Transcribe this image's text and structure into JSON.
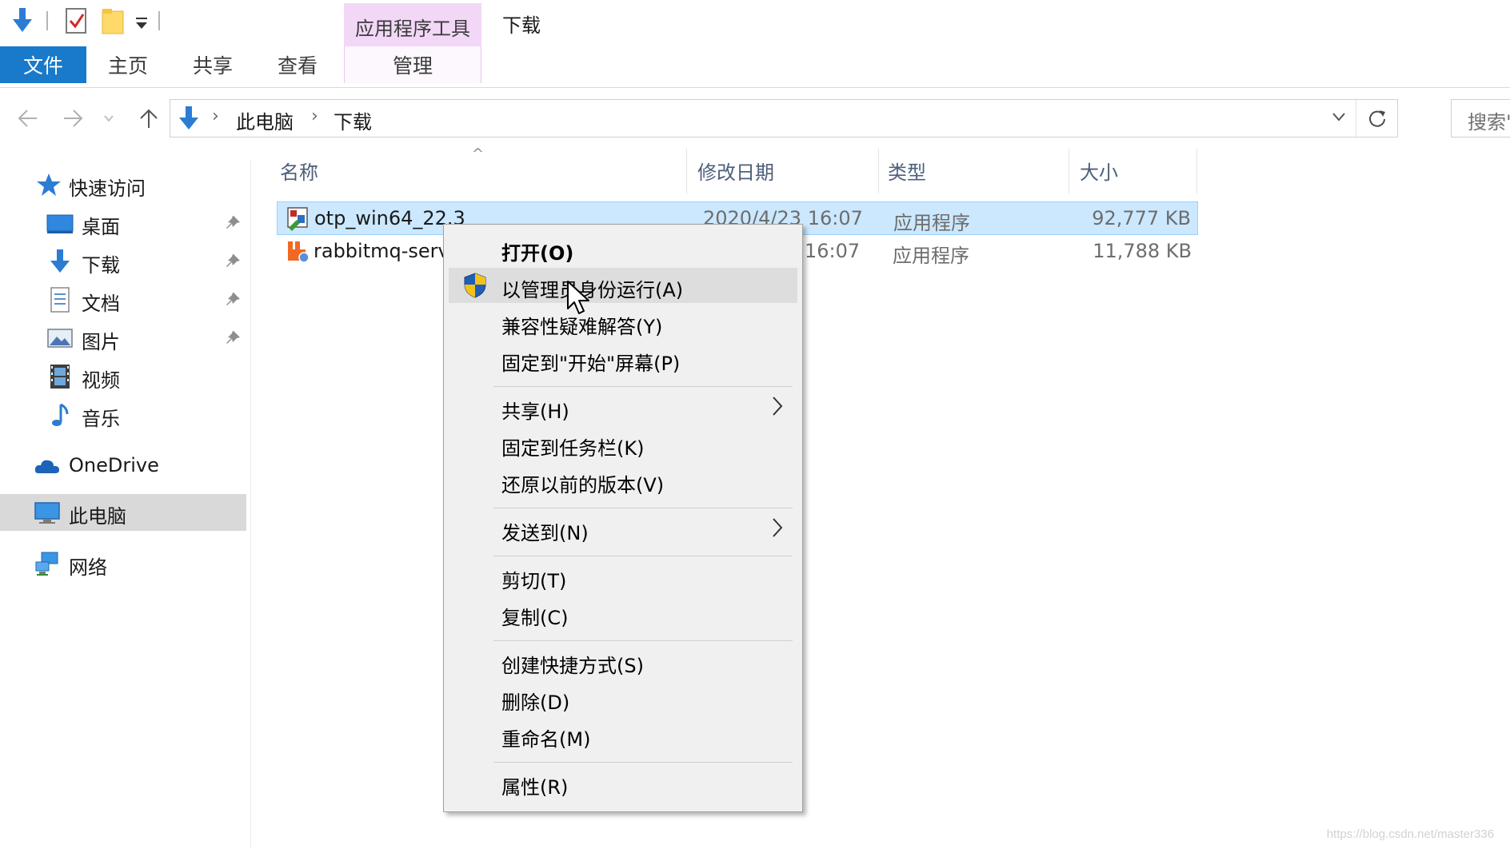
{
  "quick_access_toolbar": {
    "icons": [
      "download-arrow-icon",
      "properties-check-icon",
      "new-folder-icon",
      "customize-dropdown-icon"
    ]
  },
  "ribbon": {
    "contextual_group_label": "应用程序工具",
    "window_title": "下载",
    "tabs": {
      "file": "文件",
      "home": "主页",
      "share": "共享",
      "view": "查看",
      "manage": "管理"
    }
  },
  "address_bar": {
    "breadcrumbs": [
      "此电脑",
      "下载"
    ],
    "search_placeholder": "搜索\"下载\""
  },
  "sidebar": {
    "quick_access": "快速访问",
    "items": [
      {
        "label": "桌面",
        "icon": "desktop-icon",
        "pinned": true
      },
      {
        "label": "下载",
        "icon": "download-icon",
        "pinned": true
      },
      {
        "label": "文档",
        "icon": "documents-icon",
        "pinned": true
      },
      {
        "label": "图片",
        "icon": "pictures-icon",
        "pinned": true
      },
      {
        "label": "视频",
        "icon": "videos-icon",
        "pinned": false
      },
      {
        "label": "音乐",
        "icon": "music-icon",
        "pinned": false
      }
    ],
    "onedrive": "OneDrive",
    "this_pc": "此电脑",
    "network": "网络"
  },
  "file_list": {
    "columns": {
      "name": "名称",
      "date": "修改日期",
      "type": "类型",
      "size": "大小"
    },
    "rows": [
      {
        "name": "otp_win64_22.3",
        "date": "2020/4/23 16:07",
        "type": "应用程序",
        "size": "92,777 KB",
        "selected": true
      },
      {
        "name": "rabbitmq-serv",
        "date": "16:07",
        "type": "应用程序",
        "size": "11,788 KB",
        "selected": false
      }
    ]
  },
  "context_menu": {
    "open": "打开(O)",
    "run_as_admin": "以管理员身份运行(A)",
    "troubleshoot": "兼容性疑难解答(Y)",
    "pin_start": "固定到\"开始\"屏幕(P)",
    "share": "共享(H)",
    "pin_taskbar": "固定到任务栏(K)",
    "restore_versions": "还原以前的版本(V)",
    "send_to": "发送到(N)",
    "cut": "剪切(T)",
    "copy": "复制(C)",
    "create_shortcut": "创建快捷方式(S)",
    "delete": "删除(D)",
    "rename": "重命名(M)",
    "properties": "属性(R)"
  },
  "watermark": "https://blog.csdn.net/master336",
  "colors": {
    "file_tab": "#1979ca",
    "contextual_tab": "#f2d7f7",
    "selection": "#cce8ff",
    "menu_background": "#f0f0f0"
  }
}
